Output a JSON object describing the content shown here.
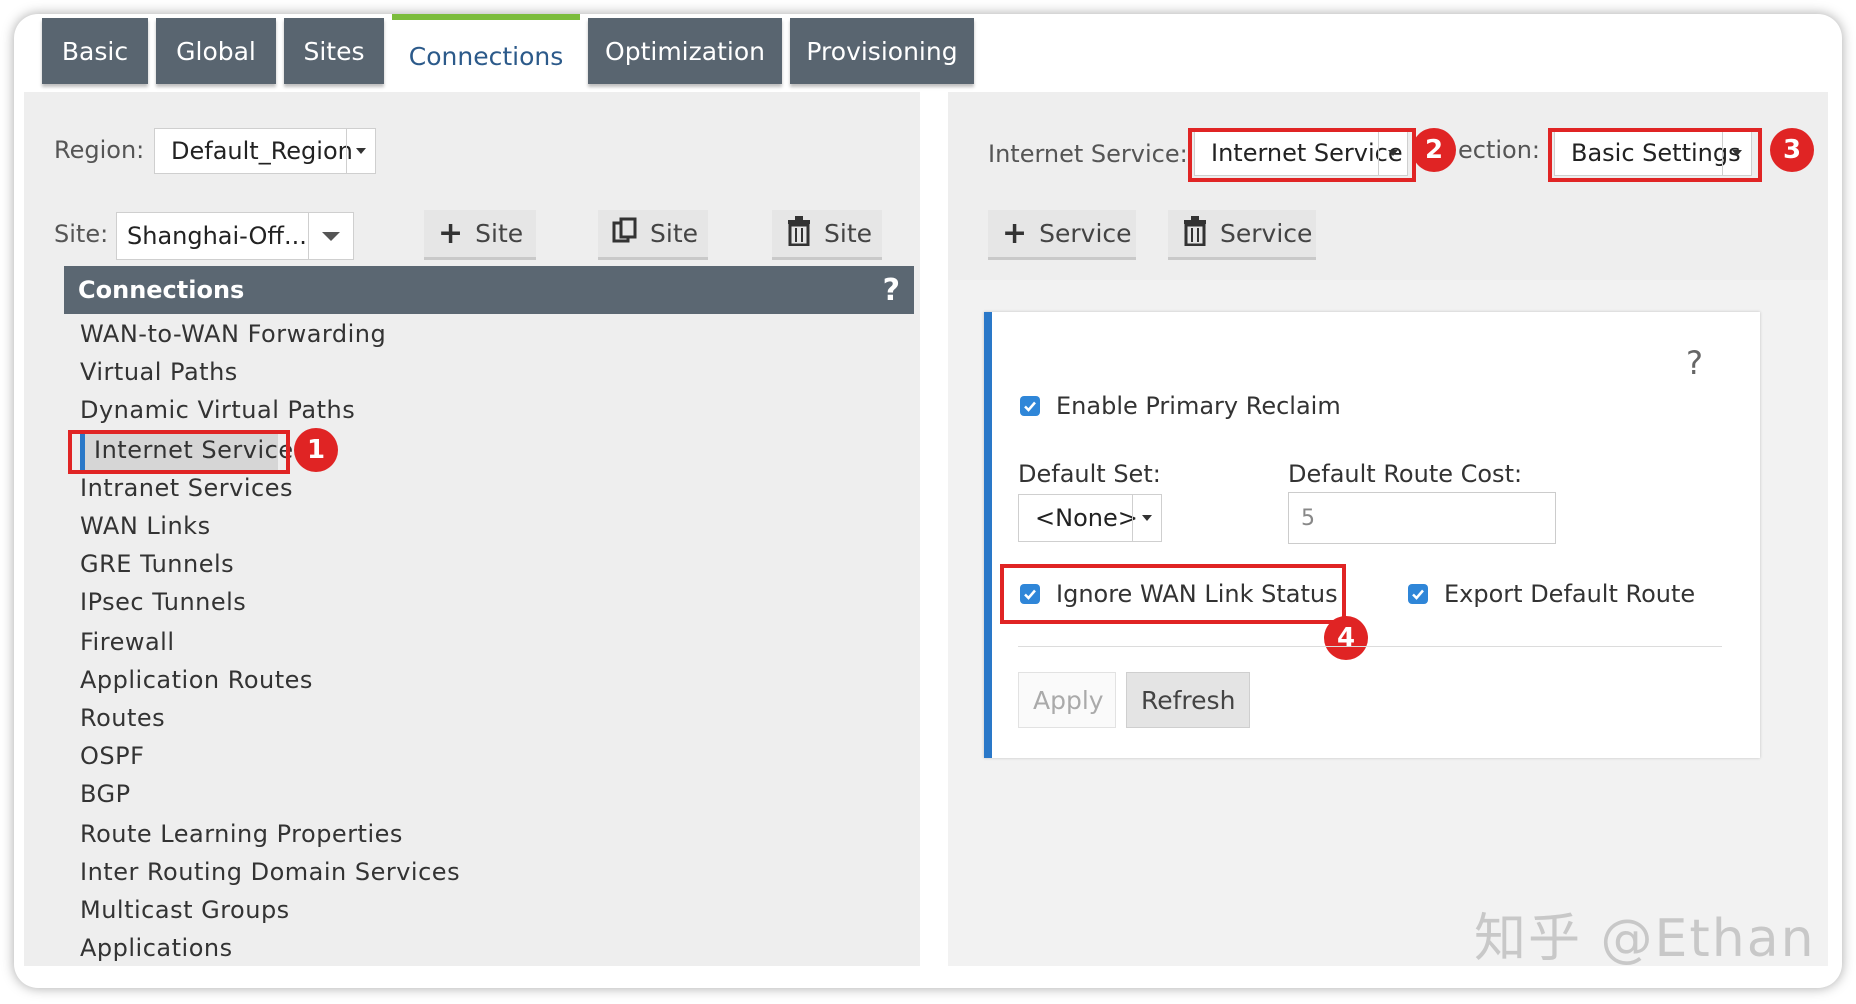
{
  "tabs": [
    {
      "label": "Basic",
      "active": false
    },
    {
      "label": "Global",
      "active": false
    },
    {
      "label": "Sites",
      "active": false
    },
    {
      "label": "Connections",
      "active": true
    },
    {
      "label": "Optimization",
      "active": false
    },
    {
      "label": "Provisioning",
      "active": false
    }
  ],
  "left": {
    "region_label": "Region:",
    "region_value": "Default_Region",
    "site_label": "Site:",
    "site_value": "Shanghai-Off...",
    "add_site_label": "Site",
    "copy_site_label": "Site",
    "delete_site_label": "Site",
    "connections_title": "Connections",
    "help_mark": "?",
    "nav_items": [
      "WAN-to-WAN Forwarding",
      "Virtual Paths",
      "Dynamic Virtual Paths",
      "Internet Service",
      "Intranet Services",
      "WAN Links",
      "GRE Tunnels",
      "IPsec Tunnels",
      "Firewall",
      "Application Routes",
      "Routes",
      "OSPF",
      "BGP",
      "Route Learning Properties",
      "Inter Routing Domain Services",
      "Multicast Groups",
      "Applications"
    ],
    "selected_item": "Internet Service"
  },
  "right": {
    "internet_service_label": "Internet Service:",
    "internet_service_value": "Internet Service",
    "section_label": "ection:",
    "section_value": "Basic Settings",
    "add_service_label": "Service",
    "delete_service_label": "Service",
    "help_mark": "?",
    "enable_primary_reclaim": {
      "label": "Enable Primary Reclaim",
      "checked": true
    },
    "default_set_label": "Default Set:",
    "default_set_value": "<None>",
    "default_route_cost_label": "Default Route Cost:",
    "default_route_cost_value": "5",
    "ignore_wan_link_status": {
      "label": "Ignore WAN Link Status",
      "checked": true
    },
    "export_default_route": {
      "label": "Export Default Route",
      "checked": true
    },
    "apply_label": "Apply",
    "refresh_label": "Refresh"
  },
  "annotations": {
    "badge1": "1",
    "badge2": "2",
    "badge3": "3",
    "badge4": "4"
  },
  "watermark": "知乎 @Ethan",
  "colors": {
    "tab_bg": "#596570",
    "accent_green": "#7bbc3c",
    "accent_blue": "#2a78c8",
    "annotation_red": "#e02424",
    "checkbox_blue": "#2f86d8"
  }
}
